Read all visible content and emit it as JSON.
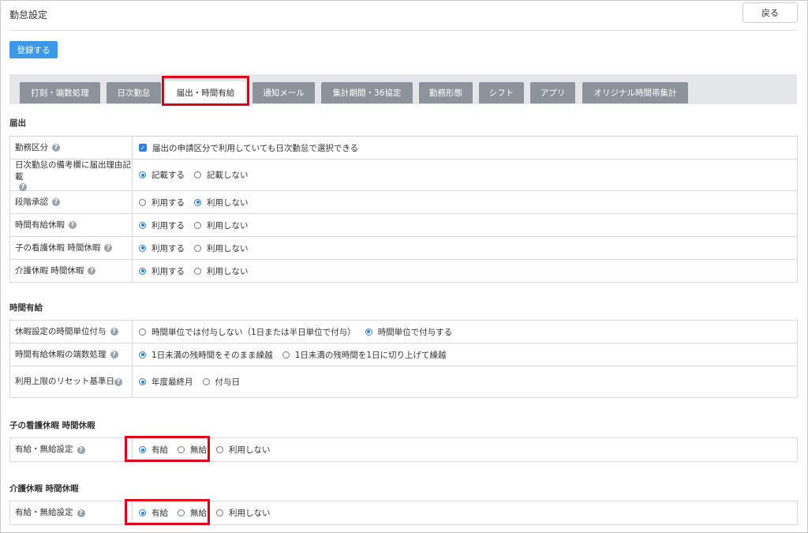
{
  "header": {
    "title": "勤怠設定",
    "back_label": "戻る"
  },
  "toolbar": {
    "register_label": "登録する"
  },
  "tabs": [
    "打刻・端数処理",
    "日次勤怠",
    "届出・時間有給",
    "通知メール",
    "集計期間・36協定",
    "勤務形態",
    "シフト",
    "アプリ",
    "オリジナル時間帯集計"
  ],
  "active_tab": "届出・時間有給",
  "help_glyph": "?",
  "sections": {
    "todokede": {
      "title": "届出",
      "rows": {
        "kinmu": {
          "label": "勤務区分",
          "checkbox": "届出の申請区分で利用していても日次勤怠で選択できる",
          "checked": true
        },
        "bikou": {
          "label": "日次勤怠の備考欄に届出理由記載",
          "opt1": "記載する",
          "opt2": "記載しない",
          "selected": "記載する"
        },
        "dankai": {
          "label": "段階承認",
          "opt1": "利用する",
          "opt2": "利用しない",
          "selected": "利用しない"
        },
        "jikan_yukyu": {
          "label": "時間有給休暇",
          "opt1": "利用する",
          "opt2": "利用しない",
          "selected": "利用する"
        },
        "kango": {
          "label": "子の看護休暇 時間休暇",
          "opt1": "利用する",
          "opt2": "利用しない",
          "selected": "利用する"
        },
        "kaigo": {
          "label": "介護休暇 時間休暇",
          "opt1": "利用する",
          "opt2": "利用しない",
          "selected": "利用する"
        }
      }
    },
    "jikanyukyu": {
      "title": "時間有給",
      "rows": {
        "fuyo": {
          "label": "休暇設定の時間単位付与",
          "opt1": "時間単位では付与しない（1日または半日単位で付与）",
          "opt2": "時間単位で付与する",
          "selected": "時間単位で付与する"
        },
        "hasu": {
          "label": "時間有給休暇の端数処理",
          "opt1": "1日未満の残時間をそのまま繰越",
          "opt2": "1日未満の残時間を1日に切り上げて繰越",
          "selected": "1日未満の残時間をそのまま繰越"
        },
        "reset": {
          "label": "利用上限のリセット基準日",
          "opt1": "年度最終月",
          "opt2": "付与日",
          "selected": "年度最終月"
        }
      }
    },
    "kango_jikan": {
      "title": "子の看護休暇 時間休暇",
      "row": {
        "label": "有給・無給設定",
        "opt1": "有給",
        "opt2": "無給",
        "opt3": "利用しない",
        "selected": "有給"
      }
    },
    "kaigo_jikan": {
      "title": "介護休暇 時間休暇",
      "row": {
        "label": "有給・無給設定",
        "opt1": "有給",
        "opt2": "無給",
        "opt3": "利用しない",
        "selected": "有給"
      }
    }
  },
  "colors": {
    "accent": "#3d98e7",
    "tab_inactive": "#8c939b",
    "highlight": "#e0001a",
    "radio": "#2f7fe0"
  }
}
